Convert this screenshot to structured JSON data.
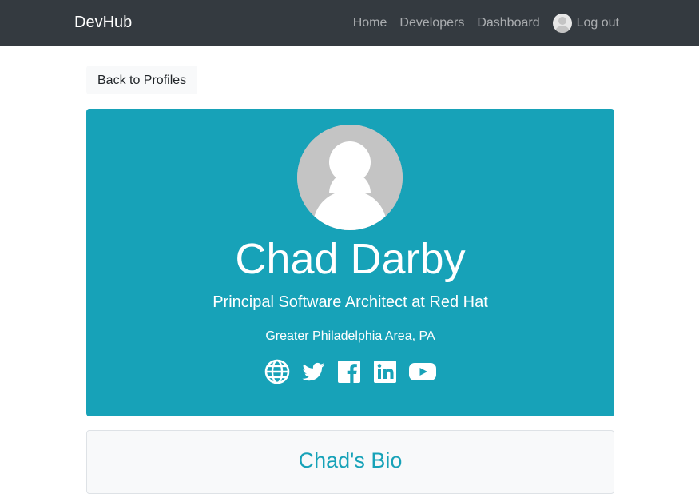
{
  "navbar": {
    "brand": "DevHub",
    "links": {
      "home": "Home",
      "developers": "Developers",
      "dashboard": "Dashboard",
      "logout": "Log out"
    }
  },
  "back_button": "Back to Profiles",
  "profile": {
    "name": "Chad Darby",
    "title": "Principal Software Architect at Red Hat",
    "location": "Greater Philadelphia Area, PA",
    "social_icons": [
      "globe-icon",
      "twitter-icon",
      "facebook-icon",
      "linkedin-icon",
      "youtube-icon"
    ]
  },
  "bio": {
    "title": "Chad's Bio"
  },
  "colors": {
    "navbar": "#343a40",
    "profile_bg": "#17a2b8",
    "bio_title": "#17a2b8"
  }
}
